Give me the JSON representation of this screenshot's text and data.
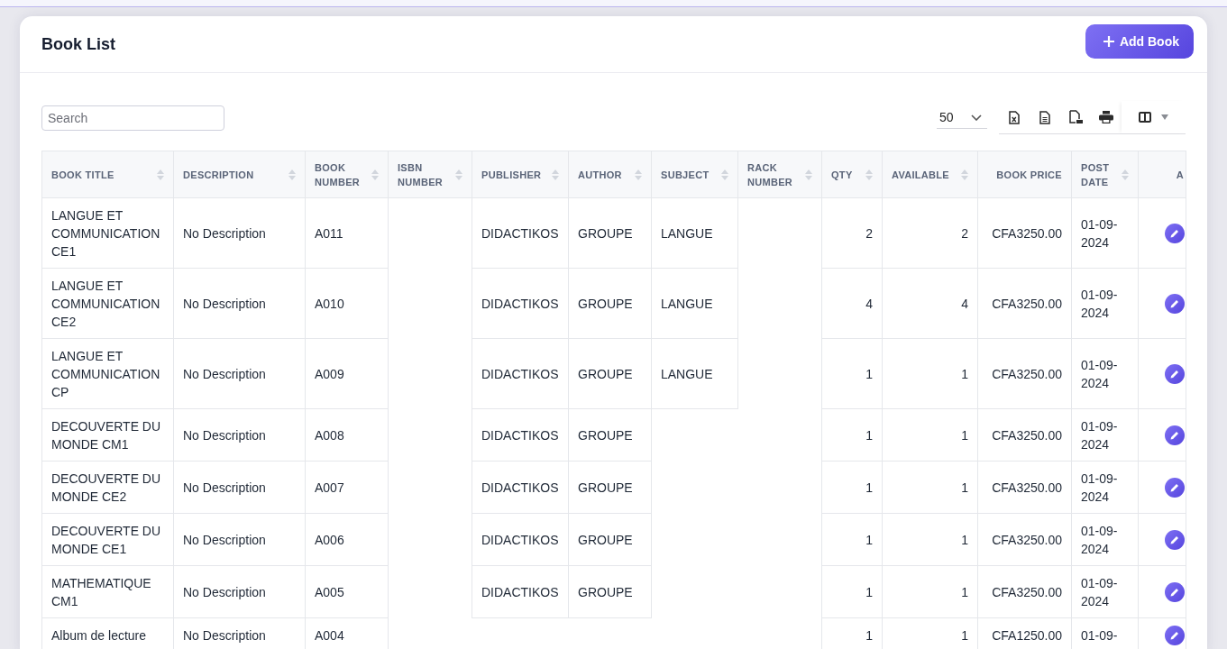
{
  "header": {
    "title": "Book List",
    "add_button": "Add Book"
  },
  "toolbar": {
    "search": {
      "placeholder": "Search"
    },
    "page_length": "50"
  },
  "table": {
    "columns": [
      {
        "label": "BOOK TITLE",
        "kind": "text",
        "sortable": true
      },
      {
        "label": "DESCRIPTION",
        "kind": "text",
        "sortable": true
      },
      {
        "label": "BOOK NUMBER",
        "kind": "text",
        "sortable": true
      },
      {
        "label": "ISBN NUMBER",
        "kind": "text",
        "sortable": true
      },
      {
        "label": "PUBLISHER",
        "kind": "text",
        "sortable": true
      },
      {
        "label": "AUTHOR",
        "kind": "text",
        "sortable": true
      },
      {
        "label": "SUBJECT",
        "kind": "text",
        "sortable": true
      },
      {
        "label": "RACK NUMBER",
        "kind": "text",
        "sortable": true
      },
      {
        "label": "QTY",
        "kind": "number",
        "sortable": true
      },
      {
        "label": "AVAILABLE",
        "kind": "number",
        "sortable": true
      },
      {
        "label": "BOOK PRICE",
        "kind": "number",
        "sortable": false
      },
      {
        "label": "POST DATE",
        "kind": "text",
        "sortable": true
      },
      {
        "label": "A",
        "kind": "action",
        "sortable": false
      }
    ],
    "rows": [
      {
        "book_title": "LANGUE ET COMMUNICATION CE1",
        "description": "No Description",
        "book_number": "A011",
        "publisher": "DIDACTIKOS",
        "author": "GROUPE",
        "subject": "LANGUE",
        "qty": "2",
        "available": "2",
        "book_price": "CFA3250.00",
        "post_date": "01-09-2024"
      },
      {
        "book_title": "LANGUE ET COMMUNICATION CE2",
        "description": "No Description",
        "book_number": "A010",
        "publisher": "DIDACTIKOS",
        "author": "GROUPE",
        "subject": "LANGUE",
        "qty": "4",
        "available": "4",
        "book_price": "CFA3250.00",
        "post_date": "01-09-2024"
      },
      {
        "book_title": "LANGUE ET COMMUNICATION CP",
        "description": "No Description",
        "book_number": "A009",
        "publisher": "DIDACTIKOS",
        "author": "GROUPE",
        "subject": "LANGUE",
        "qty": "1",
        "available": "1",
        "book_price": "CFA3250.00",
        "post_date": "01-09-2024"
      },
      {
        "book_title": "DECOUVERTE DU MONDE CM1",
        "description": "No Description",
        "book_number": "A008",
        "publisher": "DIDACTIKOS",
        "author": "GROUPE",
        "qty": "1",
        "available": "1",
        "book_price": "CFA3250.00",
        "post_date": "01-09-2024"
      },
      {
        "book_title": "DECOUVERTE DU MONDE CE2",
        "description": "No Description",
        "book_number": "A007",
        "publisher": "DIDACTIKOS",
        "author": "GROUPE",
        "qty": "1",
        "available": "1",
        "book_price": "CFA3250.00",
        "post_date": "01-09-2024"
      },
      {
        "book_title": "DECOUVERTE DU MONDE CE1",
        "description": "No Description",
        "book_number": "A006",
        "publisher": "DIDACTIKOS",
        "author": "GROUPE",
        "qty": "1",
        "available": "1",
        "book_price": "CFA3250.00",
        "post_date": "01-09-2024"
      },
      {
        "book_title": "MATHEMATIQUE CM1",
        "description": "No Description",
        "book_number": "A005",
        "publisher": "DIDACTIKOS",
        "author": "GROUPE",
        "qty": "1",
        "available": "1",
        "book_price": "CFA3250.00",
        "post_date": "01-09-2024"
      },
      {
        "book_title": "Album de lecture",
        "description": "No Description",
        "book_number": "A004",
        "qty": "1",
        "available": "1",
        "book_price": "CFA1250.00",
        "post_date": "01-09-"
      }
    ]
  }
}
